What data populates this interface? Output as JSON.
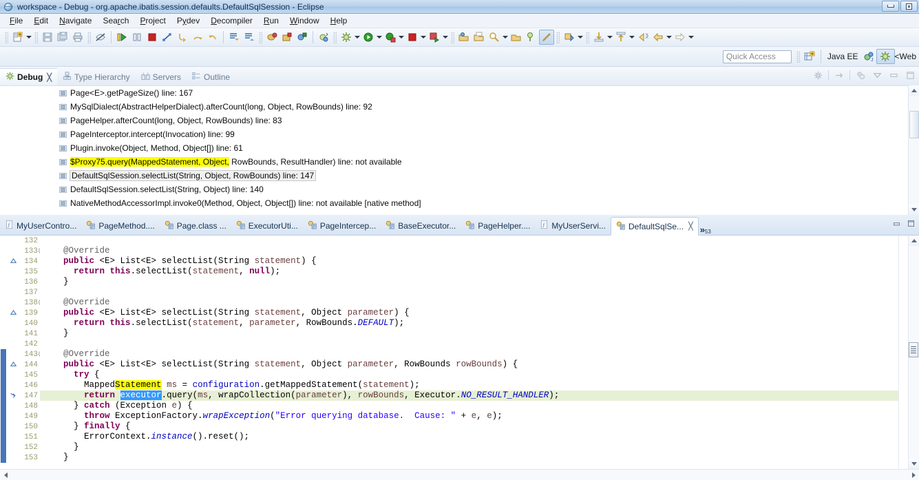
{
  "window": {
    "title": "workspace - Debug - org.apache.ibatis.session.defaults.DefaultSqlSession - Eclipse",
    "icon": "eclipse-globe-icon",
    "minimize_label": "minimize-button",
    "restore_label": "restore-button"
  },
  "menubar": {
    "items": [
      {
        "label": "File",
        "mnemonic": "F"
      },
      {
        "label": "Edit",
        "mnemonic": "E"
      },
      {
        "label": "Navigate",
        "mnemonic": "N"
      },
      {
        "label": "Search",
        "mnemonic": "c"
      },
      {
        "label": "Project",
        "mnemonic": "P"
      },
      {
        "label": "Pydev",
        "mnemonic": "y"
      },
      {
        "label": "Decompiler",
        "mnemonic": "D"
      },
      {
        "label": "Run",
        "mnemonic": "R"
      },
      {
        "label": "Window",
        "mnemonic": "W"
      },
      {
        "label": "Help",
        "mnemonic": "H"
      }
    ]
  },
  "toolbar": {
    "groups": [
      [
        "new-wizard-icon",
        "new-wizard-dropdown"
      ],
      [
        "save-icon",
        "save-all-icon",
        "print-icon"
      ],
      [
        "toggle-markoccurrences-icon"
      ],
      [
        "resume-icon",
        "suspend-icon",
        "terminate-icon",
        "disconnect-icon",
        "step-into-icon",
        "step-over-icon",
        "step-return-icon"
      ],
      [
        "next-annotation-icon",
        "previous-annotation-icon"
      ],
      [
        "new-java-project-icon",
        "new-java-package-icon",
        "new-java-class-icon"
      ],
      [
        "debug-run-icon"
      ],
      [
        "external-tools-icon",
        "run-as-icon",
        "debug-as-icon",
        "run-last-icon",
        "terminate-red-icon",
        "profile-icon"
      ],
      [
        "open-type-icon",
        "open-task-icon",
        "search-icon",
        "search-dropdown",
        "open-resource-icon",
        "pin-icon",
        "pencil-highlight-icon"
      ],
      [
        "restore-perspective-icon",
        "restore-dropdown"
      ],
      [
        "download-icon",
        "download-dropdown",
        "upload-icon",
        "upload-dropdown"
      ],
      [
        "back-history-icon",
        "back-icon",
        "back-dropdown",
        "forward-icon",
        "forward-dropdown"
      ]
    ]
  },
  "quick_access": {
    "placeholder": "Quick Access",
    "value": "",
    "open_perspective_icon": "open-perspective-icon",
    "perspectives": [
      {
        "label": "Java EE",
        "active": false,
        "icon": "java-ee-perspective-icon"
      },
      {
        "label": "<Web",
        "active": true,
        "icon": "debug-perspective-icon"
      }
    ]
  },
  "debug_view": {
    "tabs": [
      {
        "label": "Debug",
        "icon": "debug-icon",
        "active": true,
        "closeable": true
      },
      {
        "label": "Type Hierarchy",
        "icon": "type-hierarchy-icon",
        "active": false,
        "closeable": false
      },
      {
        "label": "Servers",
        "icon": "servers-icon",
        "active": false,
        "closeable": false
      },
      {
        "label": "Outline",
        "icon": "outline-icon",
        "active": false,
        "closeable": false
      }
    ],
    "close_glyph": "╳",
    "toolbar": [
      {
        "name": "disconnect-all-icon"
      },
      {
        "name": "step-return-arrow-icon"
      },
      {
        "name": "debug-filter-icon"
      },
      {
        "name": "view-menu-icon"
      },
      {
        "name": "minimize-view-icon"
      },
      {
        "name": "maximize-view-icon"
      }
    ],
    "frames": [
      {
        "text": "Page<E>.getPageSize() line: 167",
        "selected": false,
        "highlight": null
      },
      {
        "text": "MySqlDialect(AbstractHelperDialect).afterCount(long, Object, RowBounds) line: 92",
        "selected": false,
        "highlight": null
      },
      {
        "text": "PageHelper.afterCount(long, Object, RowBounds) line: 83",
        "selected": false,
        "highlight": null
      },
      {
        "text": "PageInterceptor.intercept(Invocation) line: 99",
        "selected": false,
        "highlight": null
      },
      {
        "text": "Plugin.invoke(Object, Method, Object[]) line: 61",
        "selected": false,
        "highlight": null
      },
      {
        "text": "$Proxy75.query(MappedStatement, Object, RowBounds, ResultHandler) line: not available",
        "selected": false,
        "highlight": {
          "start": 0,
          "end": 39,
          "color": "#ffff00"
        }
      },
      {
        "text": "DefaultSqlSession.selectList(String, Object, RowBounds) line: 147",
        "selected": true,
        "highlight": null
      },
      {
        "text": "DefaultSqlSession.selectList(String, Object) line: 140",
        "selected": false,
        "highlight": null
      },
      {
        "text": "NativeMethodAccessorImpl.invoke0(Method, Object, Object[]) line: not available [native method]",
        "selected": false,
        "highlight": null
      }
    ],
    "frame_icon": "stack-frame-icon"
  },
  "editor": {
    "tabs": [
      {
        "label": "MyUserContro...",
        "icon": "java-file-icon",
        "active": false
      },
      {
        "label": "PageMethod....",
        "icon": "class-file-icon",
        "active": false
      },
      {
        "label": "Page.class ...",
        "icon": "class-file-icon",
        "active": false
      },
      {
        "label": "ExecutorUti...",
        "icon": "class-file-icon",
        "active": false
      },
      {
        "label": "PageIntercep...",
        "icon": "class-file-icon",
        "active": false
      },
      {
        "label": "BaseExecutor...",
        "icon": "class-file-icon",
        "active": false
      },
      {
        "label": "PageHelper....",
        "icon": "class-file-icon",
        "active": false
      },
      {
        "label": "MyUserServi...",
        "icon": "java-file-icon",
        "active": false
      },
      {
        "label": "DefaultSqlSe...",
        "icon": "class-file-icon",
        "active": true
      }
    ],
    "close_glyph": "╳",
    "overflow_chevron": "»",
    "overflow_count": "53",
    "minimize_icon": "minimize-editor-icon",
    "maximize_icon": "maximize-editor-icon",
    "current_line": 147,
    "lines": [
      {
        "n": 132,
        "fold": false,
        "mark": null,
        "change": false,
        "tokens": []
      },
      {
        "n": 133,
        "fold": true,
        "mark": null,
        "change": false,
        "tokens": [
          {
            "t": "    ",
            "c": "plain"
          },
          {
            "t": "@Override",
            "c": "ann"
          }
        ]
      },
      {
        "n": 134,
        "fold": false,
        "mark": "override",
        "change": false,
        "tokens": [
          {
            "t": "    ",
            "c": "plain"
          },
          {
            "t": "public",
            "c": "kw"
          },
          {
            "t": " <E> List<E> selectList(String ",
            "c": "plain"
          },
          {
            "t": "statement",
            "c": "par"
          },
          {
            "t": ") {",
            "c": "plain"
          }
        ]
      },
      {
        "n": 135,
        "fold": false,
        "mark": null,
        "change": false,
        "tokens": [
          {
            "t": "      ",
            "c": "plain"
          },
          {
            "t": "return",
            "c": "kw"
          },
          {
            "t": " ",
            "c": "plain"
          },
          {
            "t": "this",
            "c": "kw"
          },
          {
            "t": ".selectList(",
            "c": "plain"
          },
          {
            "t": "statement",
            "c": "par"
          },
          {
            "t": ", ",
            "c": "plain"
          },
          {
            "t": "null",
            "c": "kw"
          },
          {
            "t": ");",
            "c": "plain"
          }
        ]
      },
      {
        "n": 136,
        "fold": false,
        "mark": null,
        "change": false,
        "tokens": [
          {
            "t": "    }",
            "c": "plain"
          }
        ]
      },
      {
        "n": 137,
        "fold": false,
        "mark": null,
        "change": false,
        "tokens": []
      },
      {
        "n": 138,
        "fold": true,
        "mark": null,
        "change": false,
        "tokens": [
          {
            "t": "    ",
            "c": "plain"
          },
          {
            "t": "@Override",
            "c": "ann"
          }
        ]
      },
      {
        "n": 139,
        "fold": false,
        "mark": "override",
        "change": false,
        "tokens": [
          {
            "t": "    ",
            "c": "plain"
          },
          {
            "t": "public",
            "c": "kw"
          },
          {
            "t": " <E> List<E> selectList(String ",
            "c": "plain"
          },
          {
            "t": "statement",
            "c": "par"
          },
          {
            "t": ", Object ",
            "c": "plain"
          },
          {
            "t": "parameter",
            "c": "par"
          },
          {
            "t": ") {",
            "c": "plain"
          }
        ]
      },
      {
        "n": 140,
        "fold": false,
        "mark": null,
        "change": false,
        "tokens": [
          {
            "t": "      ",
            "c": "plain"
          },
          {
            "t": "return",
            "c": "kw"
          },
          {
            "t": " ",
            "c": "plain"
          },
          {
            "t": "this",
            "c": "kw"
          },
          {
            "t": ".selectList(",
            "c": "plain"
          },
          {
            "t": "statement",
            "c": "par"
          },
          {
            "t": ", ",
            "c": "plain"
          },
          {
            "t": "parameter",
            "c": "par"
          },
          {
            "t": ", RowBounds.",
            "c": "plain"
          },
          {
            "t": "DEFAULT",
            "c": "sfld"
          },
          {
            "t": ");",
            "c": "plain"
          }
        ]
      },
      {
        "n": 141,
        "fold": false,
        "mark": null,
        "change": false,
        "tokens": [
          {
            "t": "    }",
            "c": "plain"
          }
        ]
      },
      {
        "n": 142,
        "fold": false,
        "mark": null,
        "change": false,
        "tokens": []
      },
      {
        "n": 143,
        "fold": true,
        "mark": null,
        "change": true,
        "tokens": [
          {
            "t": "    ",
            "c": "plain"
          },
          {
            "t": "@Override",
            "c": "ann"
          }
        ]
      },
      {
        "n": 144,
        "fold": false,
        "mark": "override",
        "change": true,
        "tokens": [
          {
            "t": "    ",
            "c": "plain"
          },
          {
            "t": "public",
            "c": "kw"
          },
          {
            "t": " <E> List<E> selectList(String ",
            "c": "plain"
          },
          {
            "t": "statement",
            "c": "par"
          },
          {
            "t": ", Object ",
            "c": "plain"
          },
          {
            "t": "parameter",
            "c": "par"
          },
          {
            "t": ", RowBounds ",
            "c": "plain"
          },
          {
            "t": "rowBounds",
            "c": "par"
          },
          {
            "t": ") {",
            "c": "plain"
          }
        ]
      },
      {
        "n": 145,
        "fold": false,
        "mark": null,
        "change": true,
        "tokens": [
          {
            "t": "      ",
            "c": "plain"
          },
          {
            "t": "try",
            "c": "kw"
          },
          {
            "t": " {",
            "c": "plain"
          }
        ]
      },
      {
        "n": 146,
        "fold": false,
        "mark": null,
        "change": true,
        "tokens": [
          {
            "t": "        Mapped",
            "c": "plain"
          },
          {
            "t": "Statement",
            "c": "ymark"
          },
          {
            "t": " ",
            "c": "plain"
          },
          {
            "t": "ms",
            "c": "par"
          },
          {
            "t": " = ",
            "c": "plain"
          },
          {
            "t": "configuration",
            "c": "fld"
          },
          {
            "t": ".getMappedStatement(",
            "c": "plain"
          },
          {
            "t": "statement",
            "c": "par"
          },
          {
            "t": ");",
            "c": "plain"
          }
        ]
      },
      {
        "n": 147,
        "fold": false,
        "mark": "instruction-pointer",
        "change": true,
        "current": true,
        "tokens": [
          {
            "t": "        ",
            "c": "plain"
          },
          {
            "t": "return",
            "c": "kw"
          },
          {
            "t": " ",
            "c": "plain"
          },
          {
            "t": "executor",
            "c": "sel"
          },
          {
            "t": ".query(",
            "c": "plain"
          },
          {
            "t": "ms",
            "c": "par"
          },
          {
            "t": ", wrapCollection(",
            "c": "plain"
          },
          {
            "t": "parameter",
            "c": "par"
          },
          {
            "t": "), ",
            "c": "plain"
          },
          {
            "t": "rowBounds",
            "c": "par"
          },
          {
            "t": ", Executor.",
            "c": "plain"
          },
          {
            "t": "NO_RESULT_HANDLER",
            "c": "sfld"
          },
          {
            "t": ");",
            "c": "plain"
          }
        ]
      },
      {
        "n": 148,
        "fold": false,
        "mark": null,
        "change": true,
        "tokens": [
          {
            "t": "      } ",
            "c": "plain"
          },
          {
            "t": "catch",
            "c": "kw"
          },
          {
            "t": " (Exception ",
            "c": "plain"
          },
          {
            "t": "e",
            "c": "par"
          },
          {
            "t": ") {",
            "c": "plain"
          }
        ]
      },
      {
        "n": 149,
        "fold": false,
        "mark": null,
        "change": true,
        "tokens": [
          {
            "t": "        ",
            "c": "plain"
          },
          {
            "t": "throw",
            "c": "kw"
          },
          {
            "t": " ExceptionFactory.",
            "c": "plain"
          },
          {
            "t": "wrapException",
            "c": "sfld"
          },
          {
            "t": "(",
            "c": "plain"
          },
          {
            "t": "\"Error querying database.  Cause: \"",
            "c": "str"
          },
          {
            "t": " + ",
            "c": "plain"
          },
          {
            "t": "e",
            "c": "par"
          },
          {
            "t": ", ",
            "c": "plain"
          },
          {
            "t": "e",
            "c": "par"
          },
          {
            "t": ");",
            "c": "plain"
          }
        ]
      },
      {
        "n": 150,
        "fold": false,
        "mark": null,
        "change": true,
        "tokens": [
          {
            "t": "      } ",
            "c": "plain"
          },
          {
            "t": "finally",
            "c": "kw"
          },
          {
            "t": " {",
            "c": "plain"
          }
        ]
      },
      {
        "n": 151,
        "fold": false,
        "mark": null,
        "change": true,
        "tokens": [
          {
            "t": "        ErrorContext.",
            "c": "plain"
          },
          {
            "t": "instance",
            "c": "sfld"
          },
          {
            "t": "().reset();",
            "c": "plain"
          }
        ]
      },
      {
        "n": 152,
        "fold": false,
        "mark": null,
        "change": true,
        "tokens": [
          {
            "t": "      }",
            "c": "plain"
          }
        ]
      },
      {
        "n": 153,
        "fold": false,
        "mark": null,
        "change": true,
        "tokens": [
          {
            "t": "    }",
            "c": "plain"
          }
        ]
      }
    ]
  },
  "colors": {
    "keyword": "#7f0055",
    "field": "#0000c0",
    "parameter": "#6a3e3e",
    "string": "#2a00ff",
    "annotation": "#646464",
    "current_line_bg": "#e6f0d4",
    "selection_bg": "#3399ff",
    "search_highlight": "#ffff00",
    "accent": "#3b6ea5"
  }
}
